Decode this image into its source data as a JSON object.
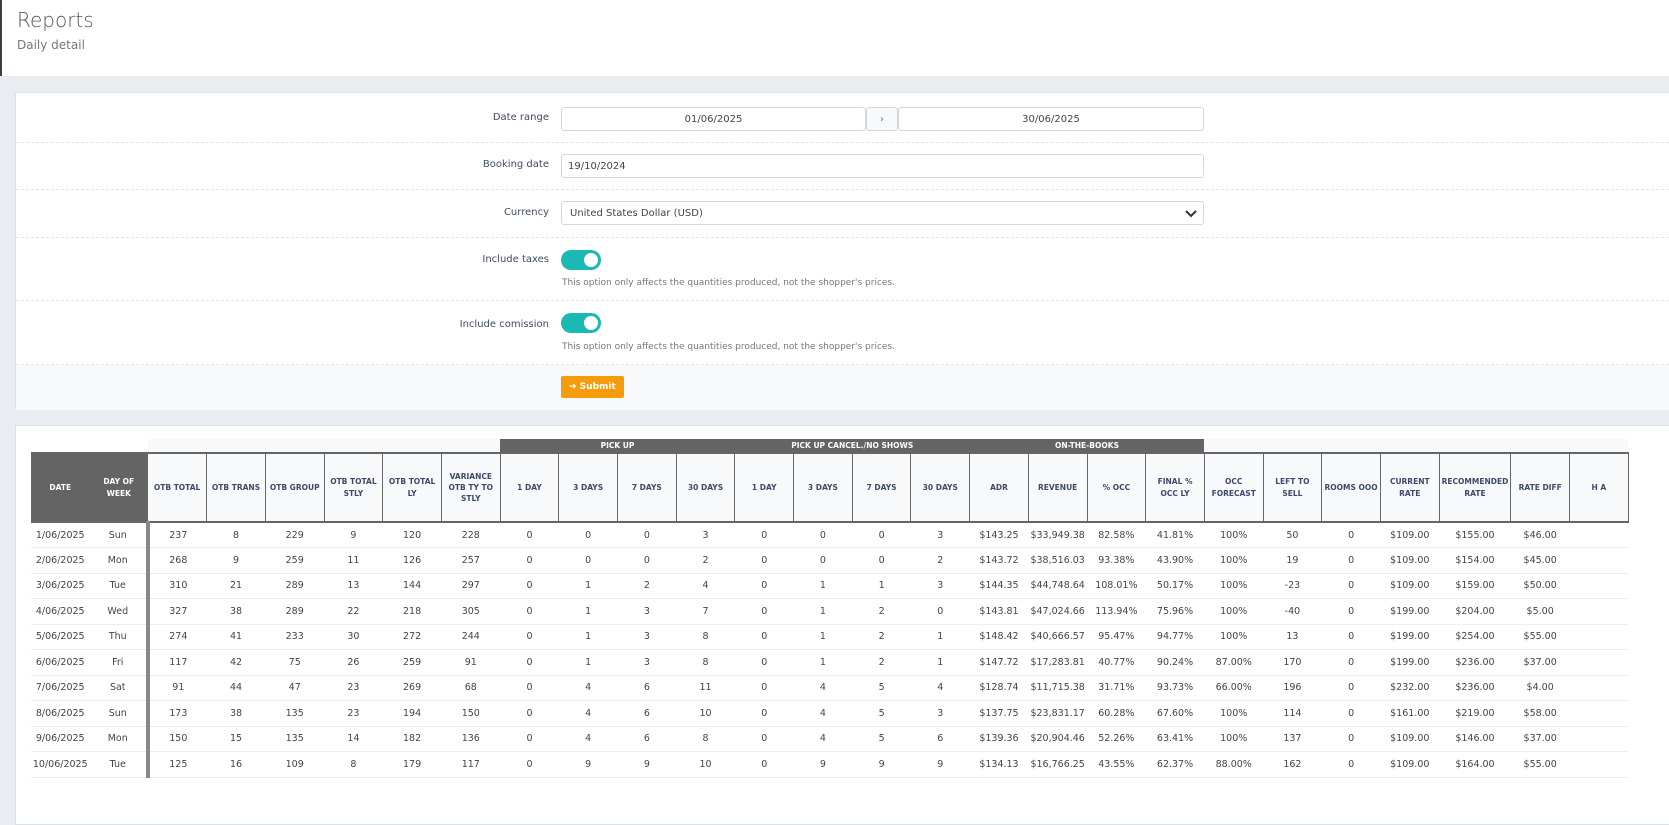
{
  "header": {
    "title": "Reports",
    "subtitle": "Daily detail"
  },
  "form": {
    "date_range": {
      "label": "Date range",
      "from": "01/06/2025",
      "separator": "›",
      "to": "30/06/2025"
    },
    "booking_date": {
      "label": "Booking date",
      "value": "19/10/2024"
    },
    "currency": {
      "label": "Currency",
      "value": "United States Dollar (USD)"
    },
    "include_taxes": {
      "label": "Include taxes",
      "on": true,
      "help": "This option only affects the quantities produced, not the shopper's prices."
    },
    "include_comission": {
      "label": "Include comission",
      "on": true,
      "help": "This option only affects the quantities produced, not the shopper's prices."
    },
    "submit_label": "➔ Submit",
    "accent": "#1cb9b4",
    "submit_color": "#f59c0c"
  },
  "table": {
    "groups": [
      {
        "label": "",
        "span": 8
      },
      {
        "label": "PICK UP",
        "span": 4
      },
      {
        "label": "PICK UP CANCEL./NO SHOWS",
        "span": 4
      },
      {
        "label": "ON-THE-BOOKS",
        "span": 4
      },
      {
        "label": "",
        "span": 7
      }
    ],
    "columns": [
      "DATE",
      "DAY OF WEEK",
      "OTB TOTAL",
      "OTB TRANS",
      "OTB GROUP",
      "OTB TOTAL STLY",
      "OTB TOTAL LY",
      "VARIANCE OTB TY TO STLY",
      "1 DAY",
      "3 DAYS",
      "7 DAYS",
      "30 DAYS",
      "1 DAY",
      "3 DAYS",
      "7 DAYS",
      "30 DAYS",
      "ADR",
      "REVENUE",
      "% OCC",
      "FINAL % OCC LY",
      "OCC FORECAST",
      "LEFT TO SELL",
      "ROOMS OOO",
      "CURRENT RATE",
      "RECOMMENDED RATE",
      "RATE DIFF",
      "H A"
    ],
    "rows": [
      [
        "1/06/2025",
        "Sun",
        "237",
        "8",
        "229",
        "9",
        "120",
        "228",
        "0",
        "0",
        "0",
        "3",
        "0",
        "0",
        "0",
        "3",
        "$143.25",
        "$33,949.38",
        "82.58%",
        "41.81%",
        "100%",
        "50",
        "0",
        "$109.00",
        "$155.00",
        "$46.00",
        ""
      ],
      [
        "2/06/2025",
        "Mon",
        "268",
        "9",
        "259",
        "11",
        "126",
        "257",
        "0",
        "0",
        "0",
        "2",
        "0",
        "0",
        "0",
        "2",
        "$143.72",
        "$38,516.03",
        "93.38%",
        "43.90%",
        "100%",
        "19",
        "0",
        "$109.00",
        "$154.00",
        "$45.00",
        ""
      ],
      [
        "3/06/2025",
        "Tue",
        "310",
        "21",
        "289",
        "13",
        "144",
        "297",
        "0",
        "1",
        "2",
        "4",
        "0",
        "1",
        "1",
        "3",
        "$144.35",
        "$44,748.64",
        "108.01%",
        "50.17%",
        "100%",
        "-23",
        "0",
        "$109.00",
        "$159.00",
        "$50.00",
        ""
      ],
      [
        "4/06/2025",
        "Wed",
        "327",
        "38",
        "289",
        "22",
        "218",
        "305",
        "0",
        "1",
        "3",
        "7",
        "0",
        "1",
        "2",
        "0",
        "$143.81",
        "$47,024.66",
        "113.94%",
        "75.96%",
        "100%",
        "-40",
        "0",
        "$199.00",
        "$204.00",
        "$5.00",
        ""
      ],
      [
        "5/06/2025",
        "Thu",
        "274",
        "41",
        "233",
        "30",
        "272",
        "244",
        "0",
        "1",
        "3",
        "8",
        "0",
        "1",
        "2",
        "1",
        "$148.42",
        "$40,666.57",
        "95.47%",
        "94.77%",
        "100%",
        "13",
        "0",
        "$199.00",
        "$254.00",
        "$55.00",
        ""
      ],
      [
        "6/06/2025",
        "Fri",
        "117",
        "42",
        "75",
        "26",
        "259",
        "91",
        "0",
        "1",
        "3",
        "8",
        "0",
        "1",
        "2",
        "1",
        "$147.72",
        "$17,283.81",
        "40.77%",
        "90.24%",
        "87.00%",
        "170",
        "0",
        "$199.00",
        "$236.00",
        "$37.00",
        ""
      ],
      [
        "7/06/2025",
        "Sat",
        "91",
        "44",
        "47",
        "23",
        "269",
        "68",
        "0",
        "4",
        "6",
        "11",
        "0",
        "4",
        "5",
        "4",
        "$128.74",
        "$11,715.38",
        "31.71%",
        "93.73%",
        "66.00%",
        "196",
        "0",
        "$232.00",
        "$236.00",
        "$4.00",
        ""
      ],
      [
        "8/06/2025",
        "Sun",
        "173",
        "38",
        "135",
        "23",
        "194",
        "150",
        "0",
        "4",
        "6",
        "10",
        "0",
        "4",
        "5",
        "3",
        "$137.75",
        "$23,831.17",
        "60.28%",
        "67.60%",
        "100%",
        "114",
        "0",
        "$161.00",
        "$219.00",
        "$58.00",
        ""
      ],
      [
        "9/06/2025",
        "Mon",
        "150",
        "15",
        "135",
        "14",
        "182",
        "136",
        "0",
        "4",
        "6",
        "8",
        "0",
        "4",
        "5",
        "6",
        "$139.36",
        "$20,904.46",
        "52.26%",
        "63.41%",
        "100%",
        "137",
        "0",
        "$109.00",
        "$146.00",
        "$37.00",
        ""
      ],
      [
        "10/06/2025",
        "Tue",
        "125",
        "16",
        "109",
        "8",
        "179",
        "117",
        "0",
        "9",
        "9",
        "10",
        "0",
        "9",
        "9",
        "9",
        "$134.13",
        "$16,766.25",
        "43.55%",
        "62.37%",
        "88.00%",
        "162",
        "0",
        "$109.00",
        "$164.00",
        "$55.00",
        ""
      ]
    ]
  }
}
